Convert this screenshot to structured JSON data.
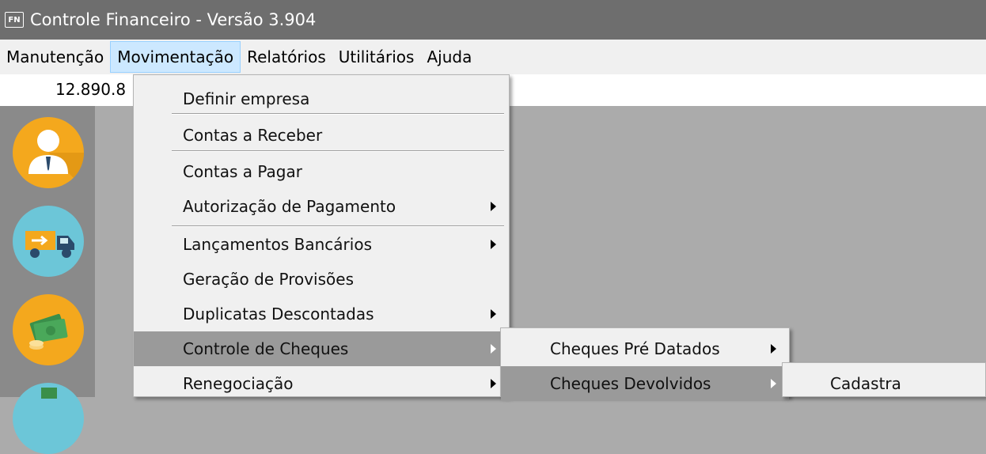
{
  "app": {
    "icon_text": "FN",
    "title": "Controle Financeiro - Versão 3.904"
  },
  "menubar": {
    "items": [
      {
        "label": "Manutenção"
      },
      {
        "label": "Movimentação"
      },
      {
        "label": "Relatórios"
      },
      {
        "label": "Utilitários"
      },
      {
        "label": "Ajuda"
      }
    ]
  },
  "status": {
    "amount": "12.890.8"
  },
  "sidebar": {
    "icons": [
      "user-icon",
      "truck-icon",
      "money-icon",
      "dollar-icon"
    ]
  },
  "movimentacao_menu": {
    "items": [
      {
        "label": "Definir empresa"
      },
      {
        "label": "Contas a Receber"
      },
      {
        "label": "Contas a Pagar"
      },
      {
        "label": "Autorização de Pagamento"
      },
      {
        "label": "Lançamentos Bancários"
      },
      {
        "label": "Geração de Provisões"
      },
      {
        "label": "Duplicatas Descontadas"
      },
      {
        "label": "Controle de Cheques"
      },
      {
        "label": "Renegociação"
      }
    ]
  },
  "cheques_menu": {
    "items": [
      {
        "label": "Cheques Pré Datados"
      },
      {
        "label": "Cheques Devolvidos"
      }
    ]
  },
  "devolvidos_menu": {
    "items": [
      {
        "label": "Cadastra"
      }
    ]
  },
  "colors": {
    "highlight": "#9a9a9a",
    "menu_bg": "#f0f0f0",
    "titlebar": "#6e6e6e",
    "sidebar": "#8a8a8a"
  }
}
